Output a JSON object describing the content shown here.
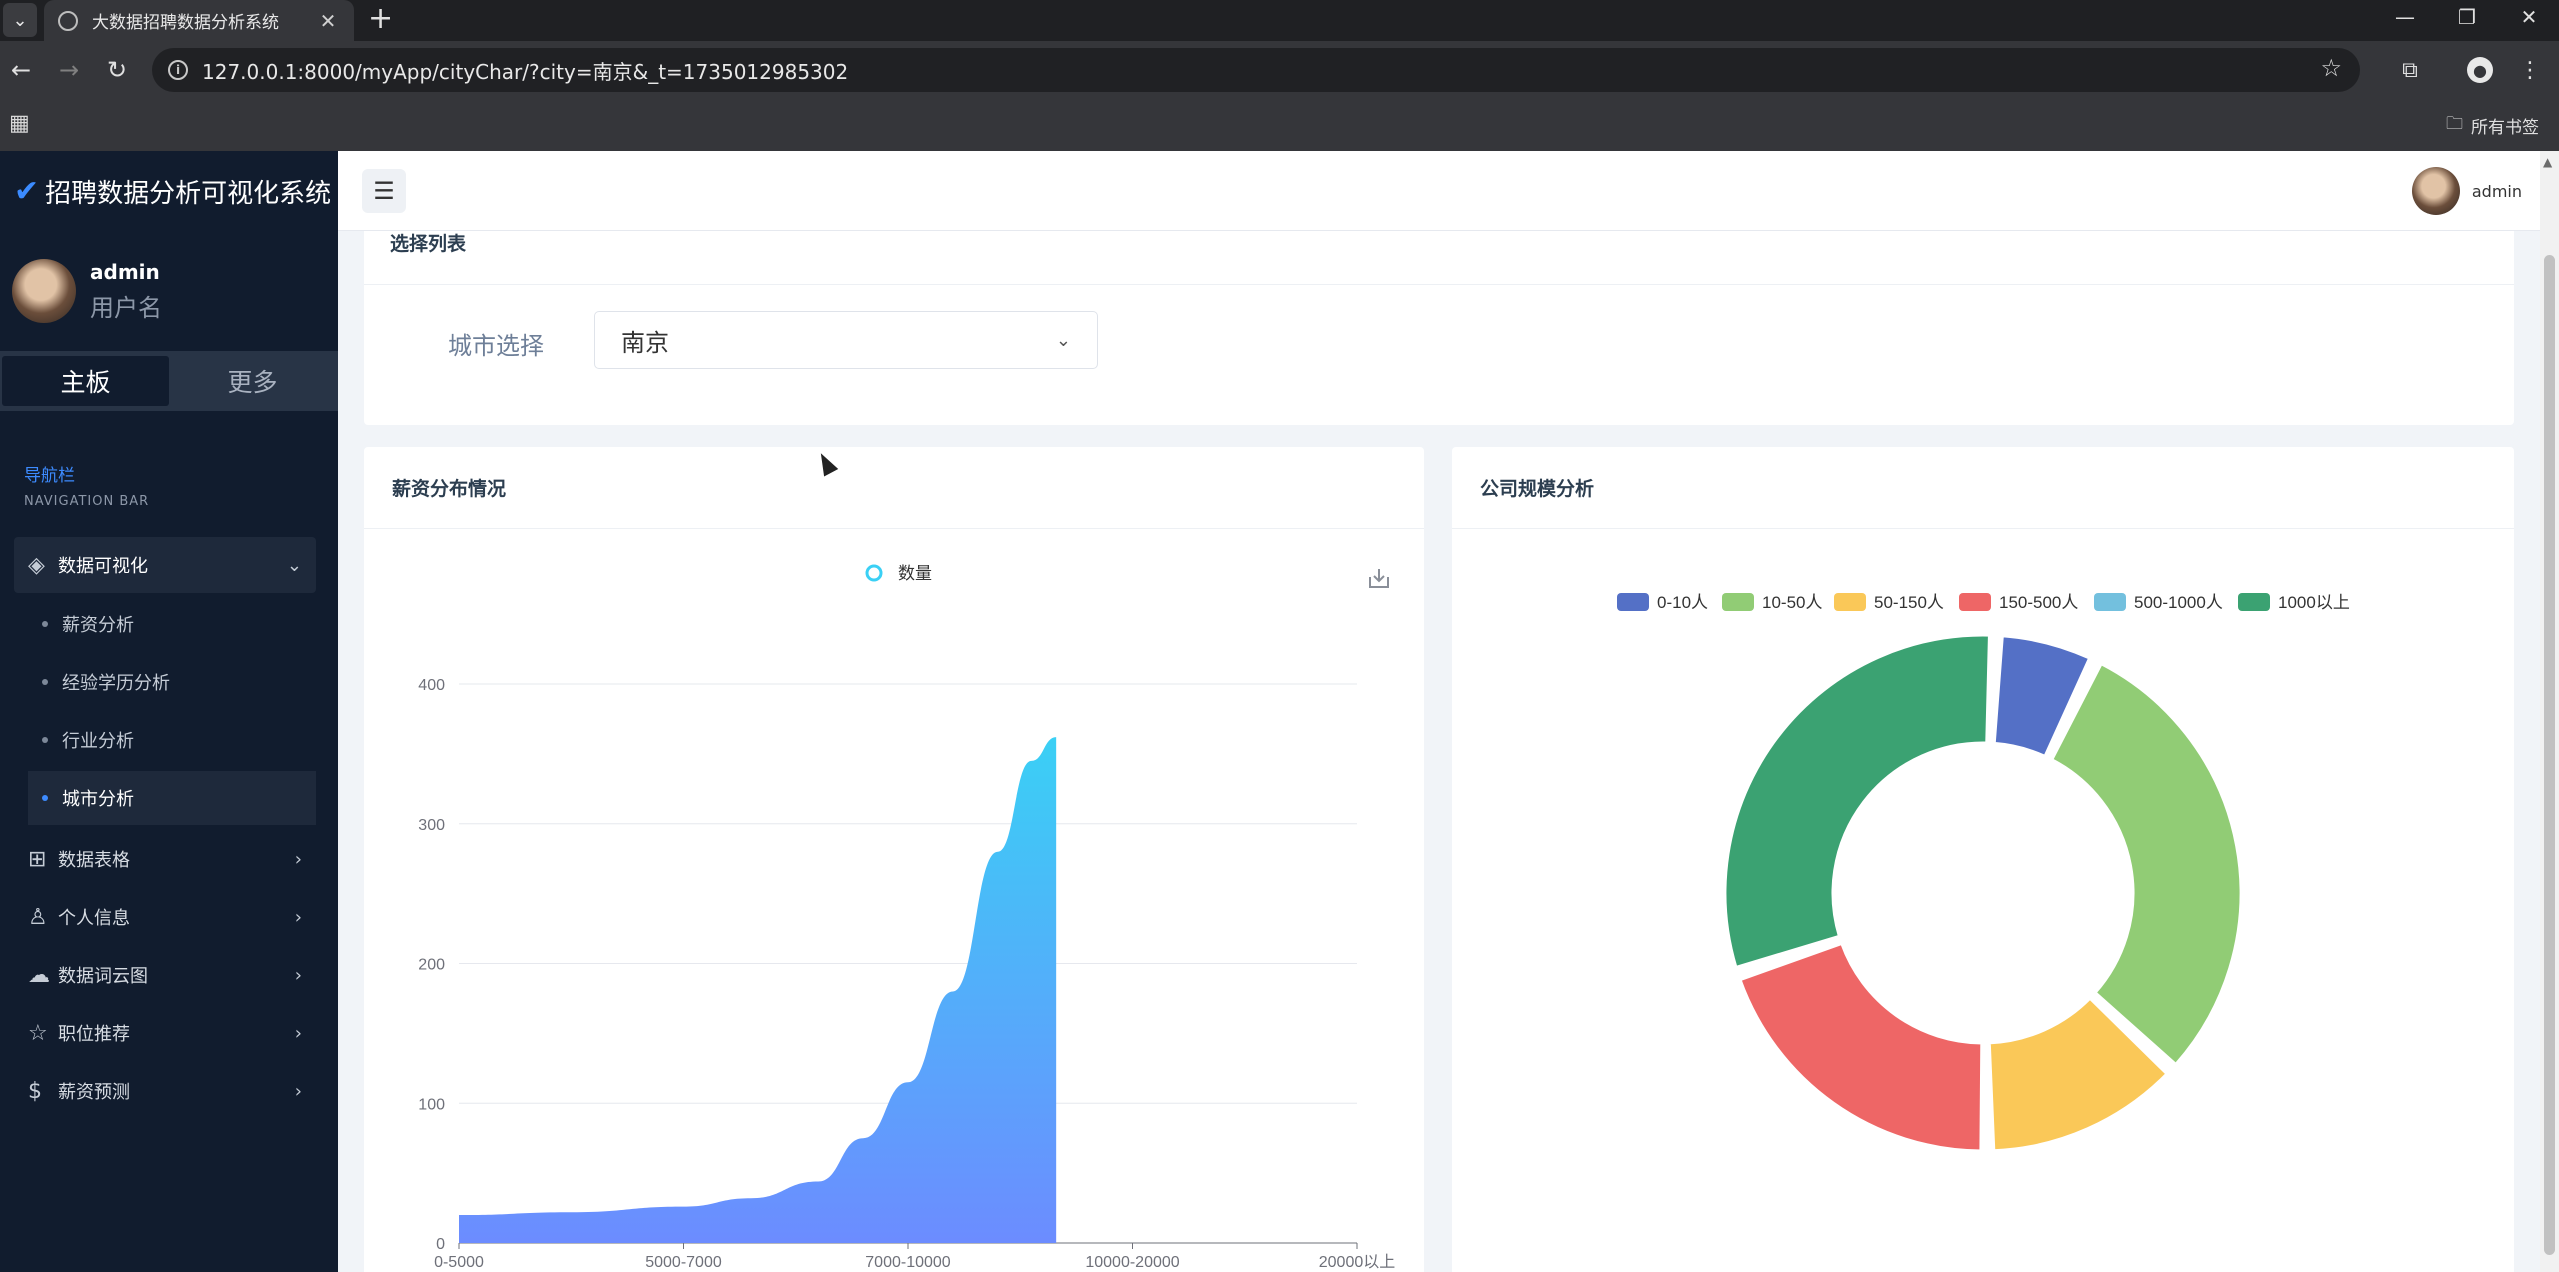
{
  "browser": {
    "tab_title": "大数据招聘数据分析系统",
    "url": "127.0.0.1:8000/myApp/cityChar/?city=南京&_t=1735012985302",
    "bookmark_folder": "所有书签"
  },
  "sidebar": {
    "brand": "招聘数据分析可视化系统",
    "user_name": "admin",
    "user_role": "用户名",
    "tabs": [
      "主板",
      "更多"
    ],
    "nav_header_cn": "导航栏",
    "nav_header_en": "NAVIGATION BAR",
    "group": {
      "label": "数据可视化",
      "items": [
        "薪资分析",
        "经验学历分析",
        "行业分析",
        "城市分析"
      ]
    },
    "menu": [
      "数据表格",
      "个人信息",
      "数据词云图",
      "职位推荐",
      "薪资预测"
    ]
  },
  "topbar": {
    "user_name": "admin"
  },
  "filter": {
    "title": "选择列表",
    "label": "城市选择",
    "selected": "南京"
  },
  "salary_card": {
    "title": "薪资分布情况"
  },
  "company_card": {
    "title": "公司规模分析"
  },
  "chart_data": [
    {
      "type": "area",
      "legend": [
        "数量"
      ],
      "categories": [
        "0-5000",
        "5000-7000",
        "7000-10000",
        "10000-20000",
        "20000以上"
      ],
      "ylim": [
        0,
        400
      ],
      "yticks": [
        0,
        100,
        200,
        300,
        400
      ],
      "series": [
        {
          "name": "数量",
          "x": [
            0,
            0.5,
            1,
            1.3,
            1.6,
            1.8,
            2.0,
            2.2,
            2.4,
            2.55,
            2.66
          ],
          "values": [
            20,
            22,
            26,
            32,
            44,
            75,
            115,
            180,
            280,
            345,
            362
          ]
        }
      ],
      "colors": [
        "#3ad0f5",
        "#6c8cff"
      ]
    },
    {
      "type": "pie",
      "legend": [
        "0-10人",
        "10-50人",
        "50-150人",
        "150-500人",
        "500-1000人",
        "1000以上"
      ],
      "values": [
        6,
        28,
        12,
        19,
        0.001,
        29
      ],
      "colors": [
        "#5470c6",
        "#91cc75",
        "#fac858",
        "#ee6666",
        "#73c0de",
        "#3ba272"
      ]
    }
  ]
}
